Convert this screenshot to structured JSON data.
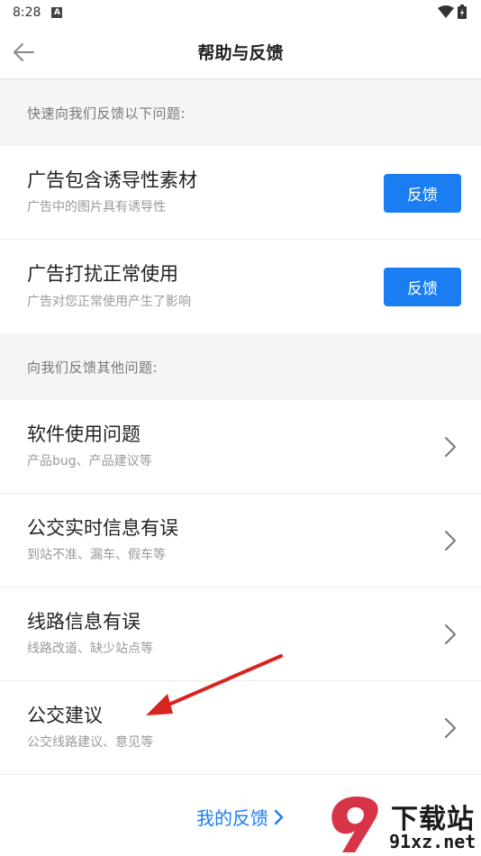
{
  "status_bar": {
    "time": "8:28",
    "notification_letter": "A"
  },
  "header": {
    "title": "帮助与反馈"
  },
  "sections": {
    "quick_label": "快速向我们反馈以下问题:",
    "other_label": "向我们反馈其他问题:"
  },
  "ad_items": [
    {
      "title": "广告包含诱导性素材",
      "subtitle": "广告中的图片具有诱导性",
      "button": "反馈"
    },
    {
      "title": "广告打扰正常使用",
      "subtitle": "广告对您正常使用产生了影响",
      "button": "反馈"
    }
  ],
  "other_items": [
    {
      "title": "软件使用问题",
      "subtitle": "产品bug、产品建议等"
    },
    {
      "title": "公交实时信息有误",
      "subtitle": "到站不准、漏车、假车等"
    },
    {
      "title": "线路信息有误",
      "subtitle": "线路改道、缺少站点等"
    },
    {
      "title": "公交建议",
      "subtitle": "公交线路建议、意见等"
    }
  ],
  "footer": {
    "my_feedback": "我的反馈"
  },
  "watermark": {
    "brand": "下载站",
    "site": "91xz.net"
  },
  "colors": {
    "accent": "#1a7ef2",
    "section_bg": "#f5f5f5",
    "annotation_arrow": "#d9231d"
  }
}
